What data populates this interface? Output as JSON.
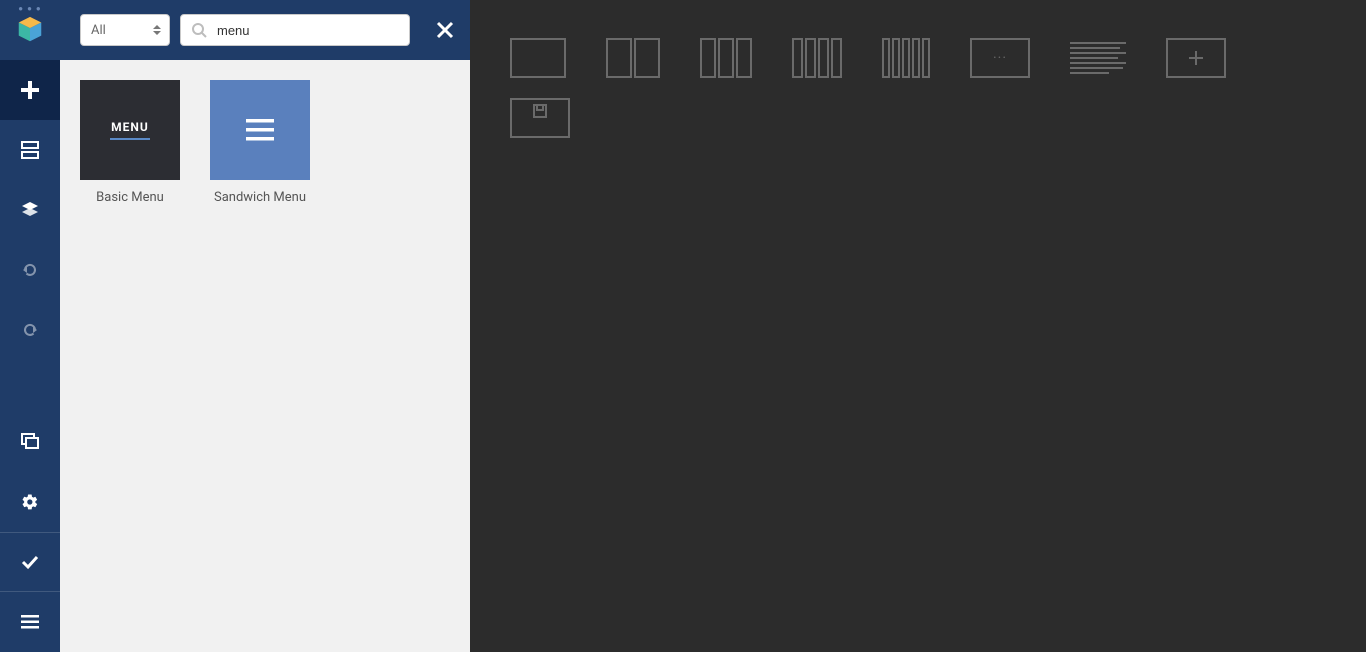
{
  "sidebar": {
    "items": [
      {
        "name": "add",
        "active": true
      },
      {
        "name": "row"
      },
      {
        "name": "layers"
      },
      {
        "name": "undo"
      },
      {
        "name": "redo"
      },
      {
        "name": "tree"
      },
      {
        "name": "settings"
      },
      {
        "name": "done"
      },
      {
        "name": "menu"
      }
    ]
  },
  "panel": {
    "category_label": "All",
    "search_value": "menu",
    "search_placeholder": "",
    "elements": [
      {
        "label": "Basic Menu",
        "thumb_text": "MENU",
        "type": "basic"
      },
      {
        "label": "Sandwich Menu",
        "type": "sandwich"
      }
    ]
  },
  "canvas": {
    "row1": [
      {
        "type": "cols1"
      },
      {
        "type": "cols2"
      },
      {
        "type": "cols3"
      },
      {
        "type": "cols4"
      },
      {
        "type": "cols5"
      },
      {
        "type": "dots",
        "text": "···"
      },
      {
        "type": "textlines"
      },
      {
        "type": "plus"
      }
    ],
    "row2": [
      {
        "type": "save"
      }
    ]
  },
  "colors": {
    "sidebar": "#1f3c68",
    "sidebar_active": "#0f2549",
    "panel_bg": "#f1f1f1",
    "canvas_bg": "#2c2c2c",
    "basic_thumb": "#2c2d33",
    "sandwich_thumb": "#5a80bd",
    "line": "#6a6a6a"
  }
}
